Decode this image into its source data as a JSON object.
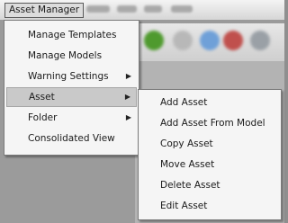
{
  "menubar": {
    "active_menu_label": "Asset Manager"
  },
  "main_menu": {
    "items": [
      {
        "label": "Manage Templates",
        "has_submenu": false
      },
      {
        "label": "Manage Models",
        "has_submenu": false
      },
      {
        "label": "Warning Settings",
        "has_submenu": true
      },
      {
        "label": "Asset",
        "has_submenu": true,
        "highlighted": true
      },
      {
        "label": "Folder",
        "has_submenu": true
      },
      {
        "label": "Consolidated View",
        "has_submenu": false
      }
    ],
    "arrow_glyph": "▶"
  },
  "asset_submenu": {
    "items": [
      {
        "label": "Add Asset"
      },
      {
        "label": "Add Asset From Model"
      },
      {
        "label": "Copy Asset"
      },
      {
        "label": "Move Asset"
      },
      {
        "label": "Delete Asset"
      },
      {
        "label": "Edit Asset"
      }
    ]
  },
  "colors": {
    "menu_background": "#f5f5f5",
    "highlight": "#c9c9c9",
    "border": "#7a7a7a"
  }
}
